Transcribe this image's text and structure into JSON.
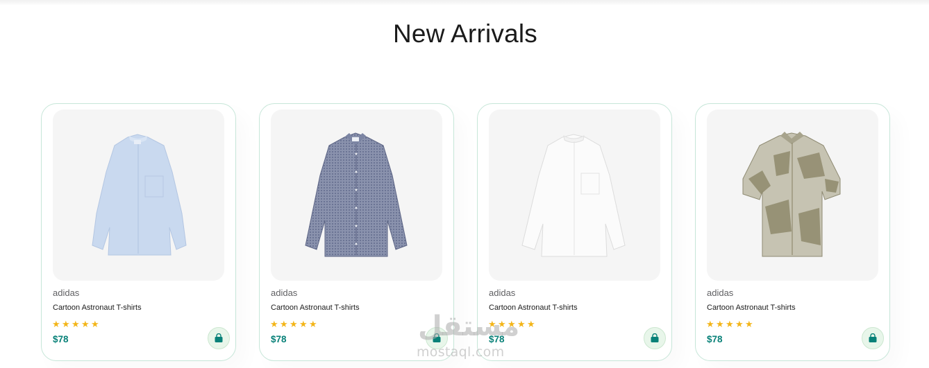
{
  "section": {
    "title": "New Arrivals"
  },
  "products": [
    {
      "image": "shirt-light-blue",
      "brand": "adidas",
      "name": "Cartoon Astronaut T-shirts",
      "rating": 5,
      "price": "$78",
      "cart_icon": "shopping-bag-icon"
    },
    {
      "image": "shirt-navy-gingham",
      "brand": "adidas",
      "name": "Cartoon Astronaut T-shirts",
      "rating": 5,
      "price": "$78",
      "cart_icon": "shopping-bag-icon"
    },
    {
      "image": "shirt-white",
      "brand": "adidas",
      "name": "Cartoon Astronaut T-shirts",
      "rating": 5,
      "price": "$78",
      "cart_icon": "shopping-bag-icon"
    },
    {
      "image": "shirt-khaki-print",
      "brand": "adidas",
      "name": "Cartoon Astronaut T-shirts",
      "rating": 5,
      "price": "$78",
      "cart_icon": "shopping-bag-icon"
    }
  ],
  "watermark": {
    "arabic": "مستقل",
    "latin": "mostaql.com"
  },
  "colors": {
    "accent": "#088178",
    "card_border": "#c6e6d8",
    "star": "#f3b519",
    "cart_bg": "#e8f6ea"
  }
}
